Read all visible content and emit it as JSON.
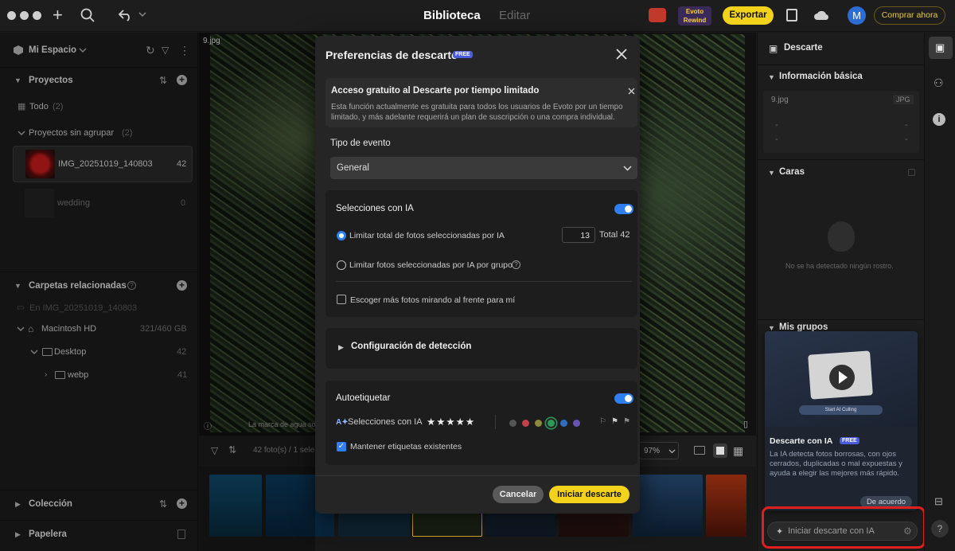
{
  "topbar": {
    "tab_library": "Biblioteca",
    "tab_edit": "Editar",
    "evoto_rewind": "Evoto Rewind",
    "export_label": "Exportar",
    "avatar_initial": "M",
    "buy_label": "Comprar ahora"
  },
  "left": {
    "workspace": "Mi Espacio",
    "projects_title": "Proyectos",
    "all_label": "Todo",
    "all_count": "(2)",
    "ungrouped_label": "Proyectos sin agrupar",
    "ungrouped_count": "(2)",
    "projects": [
      {
        "name": "IMG_20251019_140803",
        "count": "42"
      },
      {
        "name": "wedding",
        "count": "0"
      }
    ],
    "folders_title": "Carpetas relacionadas",
    "folders_in": "En IMG_20251019_140803",
    "disk_name": "Macintosh HD",
    "disk_space": "321/460 GB",
    "desktop_label": "Desktop",
    "desktop_count": "42",
    "webp_label": "webp",
    "webp_count": "41",
    "collection_title": "Colección",
    "trash_title": "Papelera"
  },
  "canvas": {
    "filename": "9.jpg",
    "watermark_note": "La marca de agua so",
    "photos_count": "42 foto(s) / 1 sele",
    "zoom": "97%"
  },
  "right": {
    "panel_title": "Descarte",
    "basic_info_title": "Información básica",
    "file_name": "9.jpg",
    "file_type": "JPG",
    "placeholder_dash": "-",
    "faces_title": "Caras",
    "no_faces": "No se ha detectado ningún rostro.",
    "groups_title": "Mis grupos",
    "promo_button": "Start AI Culling",
    "promo_title": "Descarte con IA",
    "promo_badge": "FREE",
    "promo_text": "La IA detecta fotos borrosas, con ojos cerrados, duplicadas o mal expuestas y ayuda a elegir las mejores más rápido.",
    "agree_label": "De acuerdo",
    "start_ai_label": "Iniciar descarte con IA"
  },
  "modal": {
    "title": "Preferencias de descarte",
    "title_badge": "FREE",
    "notice_title": "Acceso gratuito al Descarte por tiempo limitado",
    "notice_text": "Esta función actualmente es gratuita para todos los usuarios de Evoto por un tiempo limitado, y más adelante requerirá un plan de suscripción o una compra individual.",
    "event_type_label": "Tipo de evento",
    "event_type_value": "General",
    "ai_selection_title": "Selecciones con IA",
    "limit_total_label": "Limitar total de fotos seleccionadas por IA",
    "limit_total_value": "13",
    "total_label": "Total 42",
    "limit_group_label": "Limitar fotos seleccionadas por IA por grupo",
    "look_ahead_label": "Escoger más fotos mirando al frente para mí",
    "detection_config_label": "Configuración de detección",
    "autotag_title": "Autoetiquetar",
    "ai_selections_tag": "Selecciones con IA",
    "stars": "★★★★★",
    "keep_tags_label": "Mantener etiquetas existentes",
    "cancel_label": "Cancelar",
    "start_label": "Iniciar descarte"
  },
  "colors": {
    "accent_yellow": "#f3d21b",
    "toggle_blue": "#2f7ff0",
    "highlight_red": "#e0201e",
    "tag_dots": [
      "#555555",
      "#c2414b",
      "#8d8a3a",
      "#2e9a5a",
      "#2f6fbf",
      "#6a52b0"
    ]
  }
}
